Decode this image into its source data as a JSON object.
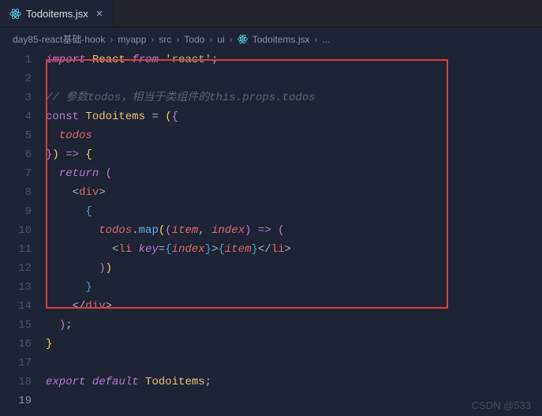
{
  "tab": {
    "label": "Todoitems.jsx"
  },
  "breadcrumb": {
    "items": [
      "day85-react基础-hook",
      "myapp",
      "src",
      "Todo",
      "ui",
      "Todoitems.jsx",
      "..."
    ],
    "sep": "›"
  },
  "lines": {
    "l1_import": "import",
    "l1_var": "React",
    "l1_from": "from",
    "l1_str": "'react'",
    "l1_semi": ";",
    "l3_comment": "// 参数todos，相当于类组件的this.props.todos",
    "l4_const": "const",
    "l4_name": "Todoitems",
    "l4_eq": " = ",
    "l4_p1": "(",
    "l4_b1": "{",
    "l5_prop": "todos",
    "l6_b": "}",
    "l6_p": ")",
    "l6_arrow": " => ",
    "l6_b2": "{",
    "l7_return": "return",
    "l7_p": " (",
    "l8_open": "<",
    "l8_tag": "div",
    "l8_close": ">",
    "l9_b": "{",
    "l10_obj": "todos",
    "l10_dot": ".",
    "l10_map": "map",
    "l10_p1": "(",
    "l10_p2": "(",
    "l10_item": "item",
    "l10_comma": ", ",
    "l10_index": "index",
    "l10_p3": ")",
    "l10_arrow": " => ",
    "l10_p4": "(",
    "l11_lt": "<",
    "l11_li": "li",
    "l11_sp": " ",
    "l11_key": "key",
    "l11_eq": "=",
    "l11_bo": "{",
    "l11_idx": "index",
    "l11_bc": "}",
    "l11_gt": ">",
    "l11_bo2": "{",
    "l11_item": "item",
    "l11_bc2": "}",
    "l11_lto": "</",
    "l11_li2": "li",
    "l11_gt2": ">",
    "l12_p1": ")",
    "l12_p2": ")",
    "l13_b": "}",
    "l14_lto": "</",
    "l14_tag": "div",
    "l14_gt": ">",
    "l15_p": ")",
    "l15_semi": ";",
    "l16_b": "}",
    "l18_export": "export",
    "l18_default": "default",
    "l18_name": "Todoitems",
    "l18_semi": ";"
  },
  "line_numbers": [
    "1",
    "2",
    "3",
    "4",
    "5",
    "6",
    "7",
    "8",
    "9",
    "10",
    "11",
    "12",
    "13",
    "14",
    "15",
    "16",
    "17",
    "18",
    "19"
  ],
  "watermark": "CSDN @533"
}
